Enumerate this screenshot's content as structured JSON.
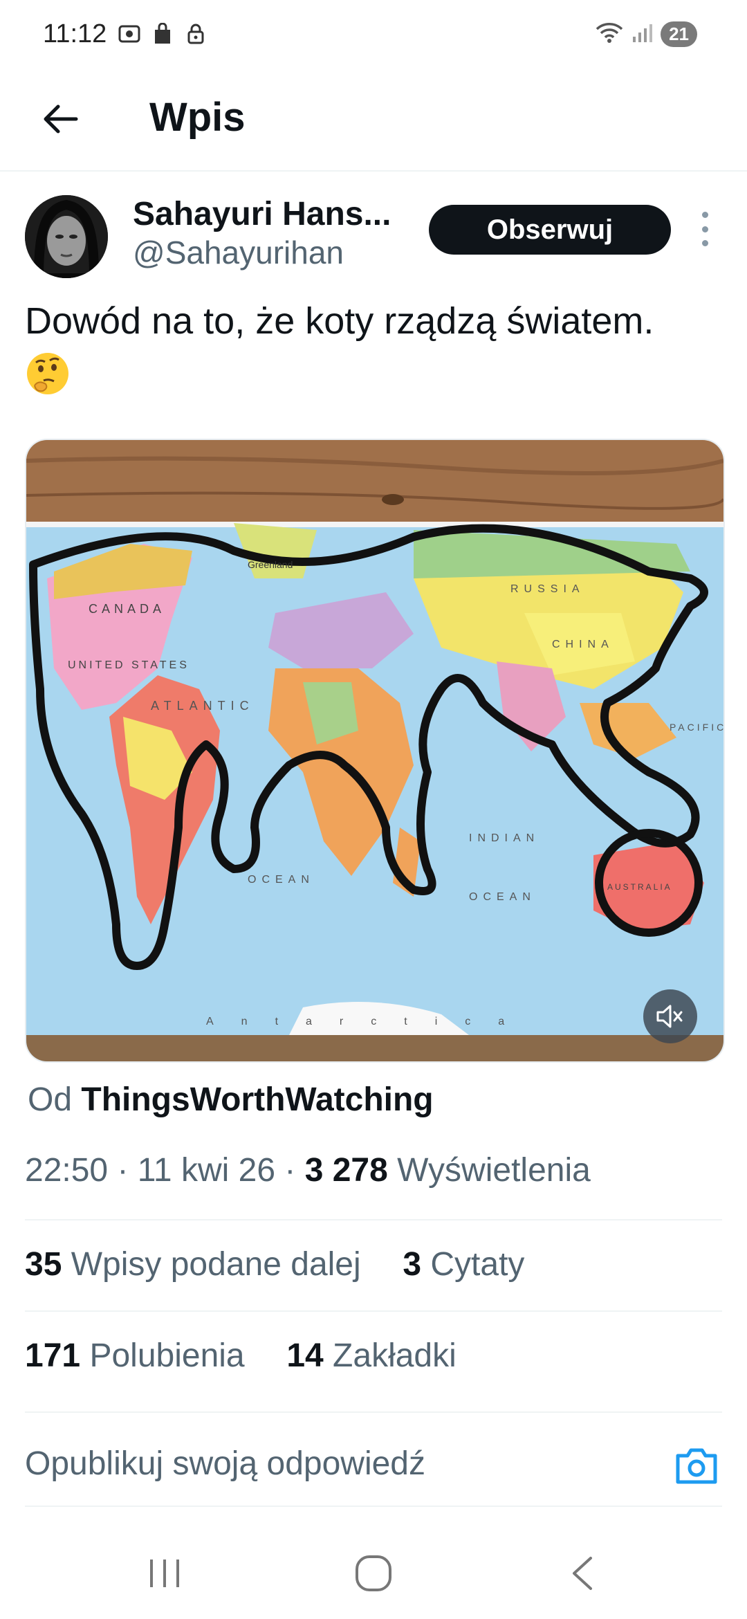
{
  "status_bar": {
    "time": "11:12",
    "battery": "21"
  },
  "header": {
    "title": "Wpis"
  },
  "author": {
    "name": "Sahayuri Hans...",
    "handle": "@Sahayurihan",
    "follow_label": "Obserwuj"
  },
  "tweet": {
    "text": "Dowód na to, że koty rządzą światem.",
    "emoji": "thinking-face"
  },
  "media": {
    "type": "video",
    "description_icons": [
      "mute-icon"
    ],
    "map_labels": {
      "greenland": "Greenland",
      "canada": "CANADA",
      "usa": "UNITED STATES",
      "atlantic": "ATLANTIC",
      "ocean1": "OCEAN",
      "ocean2": "OCEAN",
      "indian": "INDIAN",
      "pacific": "PACIFIC",
      "russia": "RUSSIA",
      "china": "CHINA",
      "australia": "AUSTRALIA",
      "antarctica": "Antarctica"
    }
  },
  "source": {
    "prefix": "Od",
    "name": "ThingsWorthWatching"
  },
  "meta": {
    "time": "22:50",
    "date": "11 kwi 26",
    "views_count": "3 278",
    "views_label": "Wyświetlenia"
  },
  "stats": {
    "reposts_count": "35",
    "reposts_label": "Wpisy podane dalej",
    "quotes_count": "3",
    "quotes_label": "Cytaty",
    "likes_count": "171",
    "likes_label": "Polubienia",
    "bookmarks_count": "14",
    "bookmarks_label": "Zakładki"
  },
  "reply": {
    "placeholder": "Opublikuj swoją odpowiedź"
  },
  "colors": {
    "accent": "#1d9bf0",
    "text_primary": "#0f1419",
    "text_secondary": "#536471",
    "divider": "#eff3f4"
  }
}
